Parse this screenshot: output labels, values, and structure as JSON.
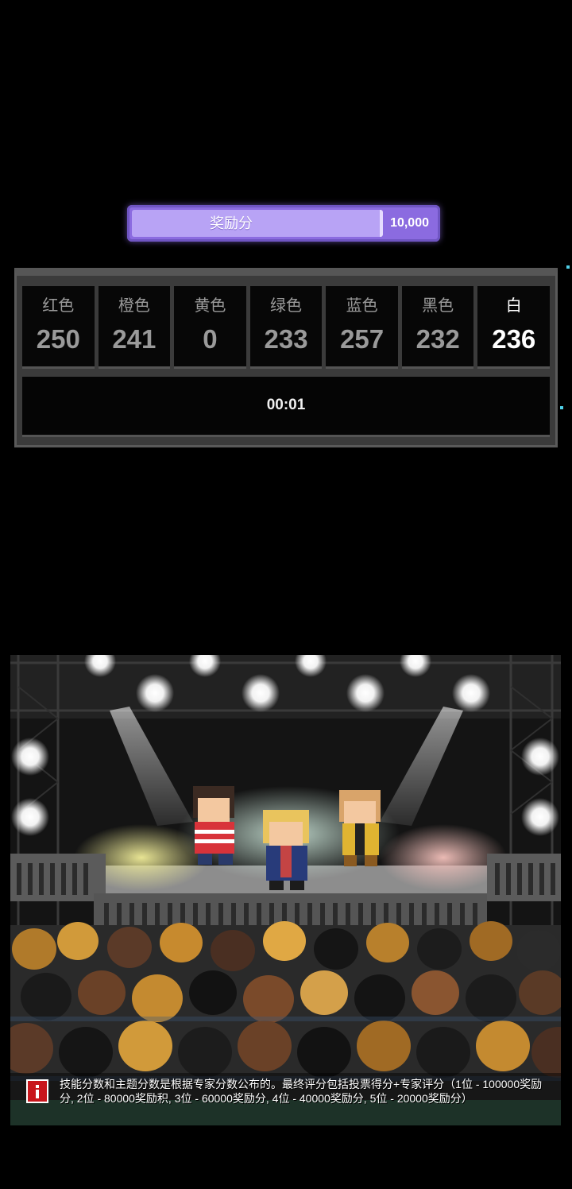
{
  "reward": {
    "label": "奖励分",
    "value": "10,000"
  },
  "teams": [
    {
      "name": "红色",
      "score": "250"
    },
    {
      "name": "橙色",
      "score": "241"
    },
    {
      "name": "黄色",
      "score": "0"
    },
    {
      "name": "绿色",
      "score": "233"
    },
    {
      "name": "蓝色",
      "score": "257"
    },
    {
      "name": "黑色",
      "score": "232"
    },
    {
      "name": "白",
      "score": "236"
    }
  ],
  "active_team": "白",
  "timer": "00:01",
  "notice": {
    "icon": "alert-icon",
    "text": "技能分数和主题分数是根据专家分数公布的。最终评分包括投票得分+专家评分（1位 - 100000奖励分, 2位 - 80000奖励积, 3位 - 60000奖励分, 4位 - 40000奖励分, 5位 - 20000奖励分）"
  },
  "colors": {
    "reward_bar": "#8b6be0",
    "board_frame": "#3b3b3b",
    "notice_icon": "#c8161c"
  }
}
